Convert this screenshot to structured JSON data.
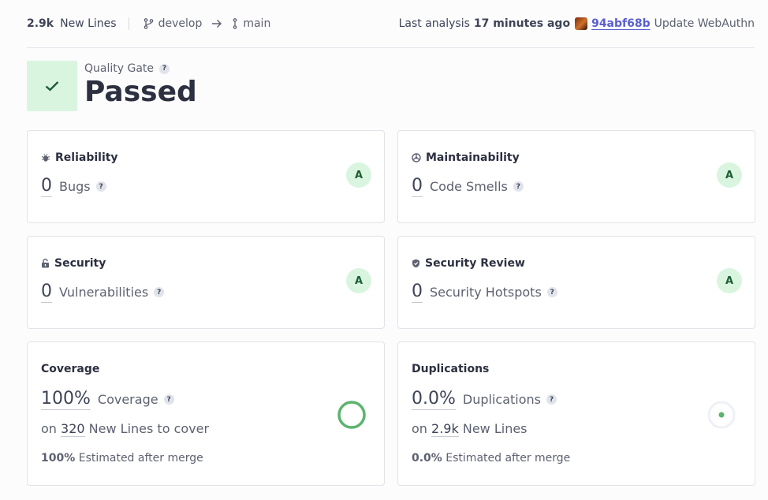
{
  "header": {
    "new_lines_count": "2.9k",
    "new_lines_label": "New Lines",
    "branch_from": "develop",
    "branch_to": "main",
    "last_analysis_label": "Last analysis",
    "last_analysis_time": "17 minutes ago",
    "commit_hash": "94abf68b",
    "commit_message": "Update WebAuthn"
  },
  "quality_gate": {
    "label": "Quality Gate",
    "status": "Passed"
  },
  "cards": {
    "reliability": {
      "title": "Reliability",
      "value": "0",
      "label": "Bugs",
      "grade": "A"
    },
    "maintainability": {
      "title": "Maintainability",
      "value": "0",
      "label": "Code Smells",
      "grade": "A"
    },
    "security": {
      "title": "Security",
      "value": "0",
      "label": "Vulnerabilities",
      "grade": "A"
    },
    "security_review": {
      "title": "Security Review",
      "value": "0",
      "label": "Security Hotspots",
      "grade": "A"
    },
    "coverage": {
      "title": "Coverage",
      "value": "100%",
      "label": "Coverage",
      "on": "on",
      "lines": "320",
      "lines_label": "New Lines to cover",
      "estimate_value": "100%",
      "estimate_label": "Estimated after merge",
      "percent": 100
    },
    "duplications": {
      "title": "Duplications",
      "value": "0.0%",
      "label": "Duplications",
      "on": "on",
      "lines": "2.9k",
      "lines_label": "New Lines",
      "estimate_value": "0.0%",
      "estimate_label": "Estimated after merge",
      "percent": 0
    }
  },
  "help_glyph": "?",
  "colors": {
    "passed_bg": "#d9f5e0",
    "passed_fg": "#1e5e33",
    "link": "#5a5fd0",
    "coverage_ring": "#5cb46e"
  }
}
